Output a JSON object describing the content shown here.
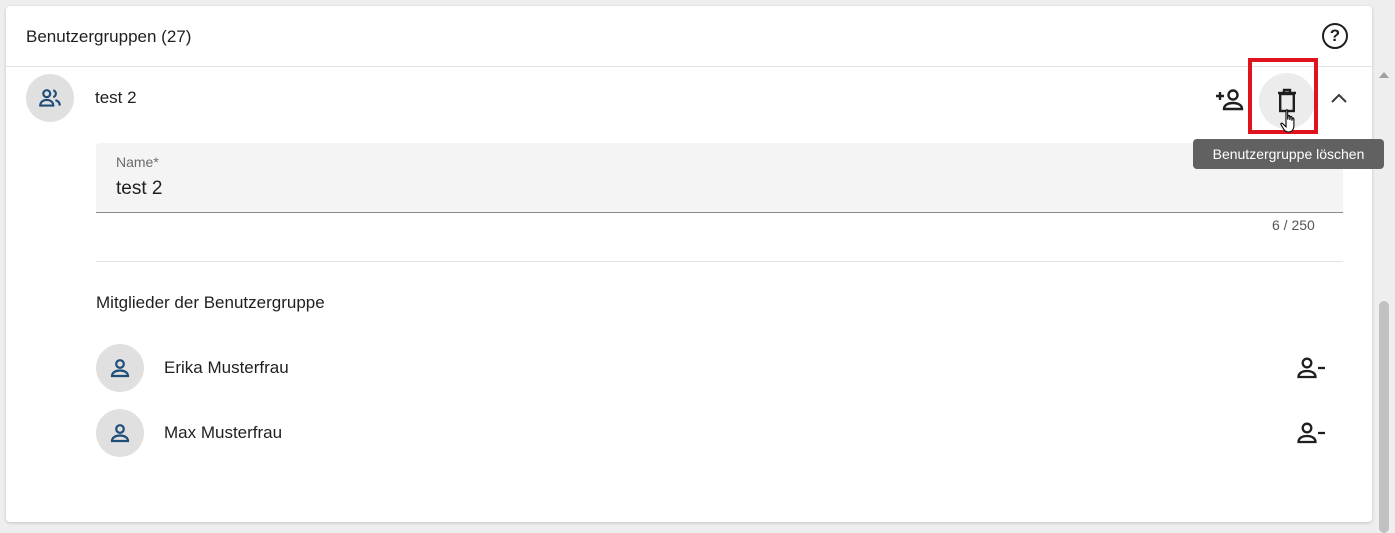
{
  "header": {
    "title": "Benutzergruppen (27)",
    "help_icon": "help-circle-icon"
  },
  "group": {
    "name": "test 2",
    "avatar_icon": "group-icon",
    "add_member_icon": "person-add-icon",
    "delete_icon": "trash-icon",
    "collapse_icon": "chevron-up-icon",
    "delete_tooltip": "Benutzergruppe löschen"
  },
  "name_field": {
    "label": "Name*",
    "value": "test 2",
    "counter": "6 / 250"
  },
  "members": {
    "title": "Mitglieder der Benutzergruppe",
    "items": [
      {
        "name": "Erika Musterfrau",
        "icon": "person-icon",
        "remove_icon": "person-remove-icon"
      },
      {
        "name": "Max Musterfrau",
        "icon": "person-icon",
        "remove_icon": "person-remove-icon"
      }
    ]
  },
  "colors": {
    "accent_icon": "#1f4e79",
    "highlight": "#e0141e",
    "tooltip_bg": "#616161"
  }
}
